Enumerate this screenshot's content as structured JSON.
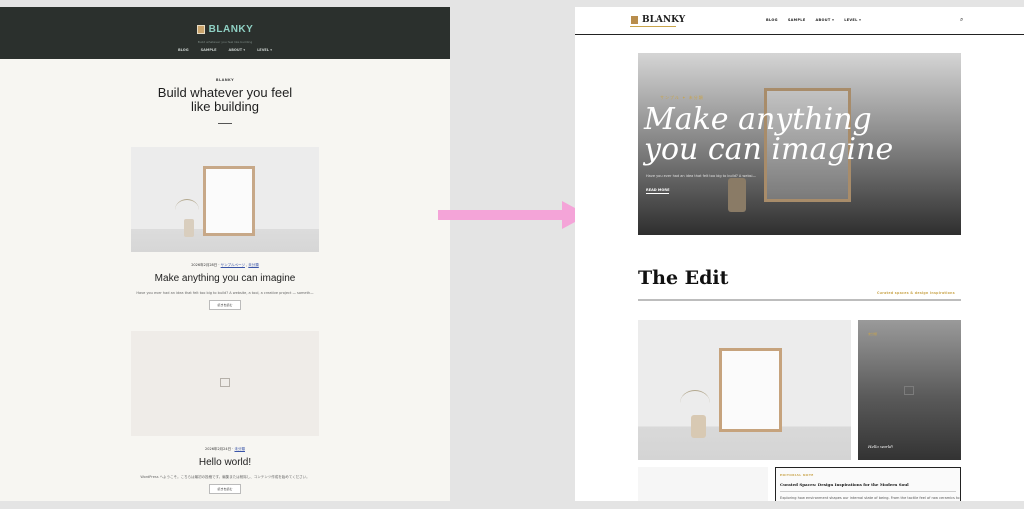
{
  "left": {
    "site": {
      "logo_text": "BLANKY",
      "tagline": "Build whatever you feel like building"
    },
    "nav": [
      "BLOG",
      "SAMPLE",
      "ABOUT ▾",
      "LEVEL ▾"
    ],
    "hero": {
      "site_label": "BLANKY",
      "title_line1": "Build whatever you feel",
      "title_line2": "like building"
    },
    "posts": [
      {
        "date": "2026年2月28日",
        "categories": [
          "サンプルページ",
          "未分類"
        ],
        "title": "Make anything you can imagine",
        "excerpt": "Have you ever had an idea that felt too big to build? A website, a tool, a creative project — someth—",
        "button": "続きを読む"
      },
      {
        "date": "2026年2月24日",
        "categories": [
          "未分類"
        ],
        "title": "Hello world!",
        "excerpt": "WordPress へようこそ。こちらは最初の投稿です。編集または削除し、コンテンツ作成を始めてください。",
        "button": "続きを読む"
      }
    ]
  },
  "right": {
    "site": {
      "logo_text": "BLANKY"
    },
    "nav": [
      "BLOG",
      "SAMPLE",
      "ABOUT ▾",
      "LEVEL ▾"
    ],
    "search_icon": "⌕",
    "hero": {
      "category": "サンプル ✦ 未分類",
      "title_line1": "Make anything",
      "title_line2": "you can imagine",
      "excerpt": "Have you ever had an idea that felt too big to build? A websi—",
      "read_more": "READ MORE"
    },
    "edit": {
      "title": "The Edit",
      "subtitle": "Curated spaces & design inspirations"
    },
    "tiles": {
      "dark_category": "未分類",
      "dark_title": "Hello world!",
      "note_category": "EDITORIAL NOTE",
      "note_title": "Curated Spaces: Design Inspirations for the Modern Soul",
      "note_excerpt": "Exploring how environment shapes our internal state of being. From the tactile feel of raw ceramics to"
    }
  },
  "colors": {
    "left_header": "#2b302d",
    "logo_accent": "#8fd1c4",
    "gold_accent": "#c9a44a",
    "arrow": "#f4a4d8"
  }
}
